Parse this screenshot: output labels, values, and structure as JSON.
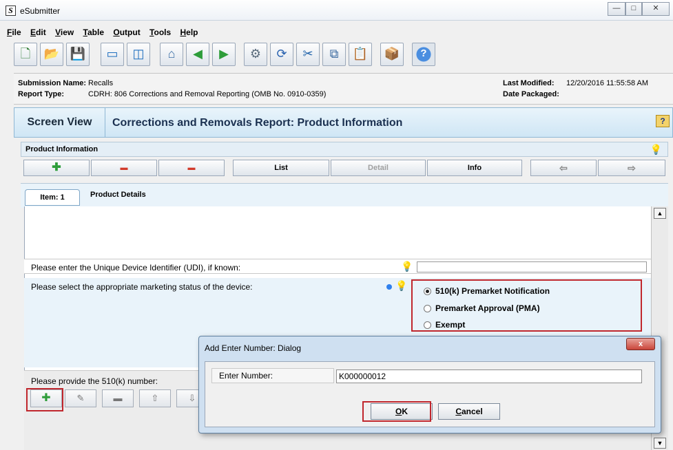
{
  "window": {
    "logo_letter": "S",
    "title": "eSubmitter",
    "minimize": "—",
    "maximize": "□",
    "close": "✕"
  },
  "menu": [
    {
      "accel": "F",
      "rest": "ile"
    },
    {
      "accel": "E",
      "rest": "dit"
    },
    {
      "accel": "V",
      "rest": "iew"
    },
    {
      "accel": "T",
      "rest": "able"
    },
    {
      "accel": "O",
      "rest": "utput"
    },
    {
      "accel": "T",
      "rest": "ools"
    },
    {
      "accel": "H",
      "rest": "elp"
    }
  ],
  "toolbar": {
    "icons": [
      "new-document-icon",
      "open-folder-icon",
      "save-icon",
      "window-icon",
      "split-view-icon",
      "home-icon",
      "back-icon",
      "forward-icon",
      "settings-icon",
      "refresh-icon",
      "cut-icon",
      "copy-icon",
      "paste-icon",
      "package-icon",
      "help-icon"
    ],
    "glyphs": [
      "🗋",
      "📂",
      "💾",
      "▭",
      "◫",
      "⌂",
      "◀",
      "▶",
      "⚙",
      "⟳",
      "✂",
      "⧉",
      "📋",
      "📦",
      "?"
    ]
  },
  "submission": {
    "name_label": "Submission Name:",
    "name_value": "Recalls",
    "type_label": "Report Type:",
    "type_value": "CDRH: 806 Corrections and Removal Reporting (OMB No. 0910-0359)",
    "modified_label": "Last Modified:",
    "modified_value": "12/20/2016 11:55:58 AM",
    "packaged_label": "Date Packaged:",
    "packaged_value": ""
  },
  "screen_view": {
    "tab_label": "Screen View",
    "title": "Corrections and Removals Report: Product Information",
    "help_glyph": "?"
  },
  "product_info": {
    "header": "Product Information",
    "buttons": {
      "add": "✚",
      "delete": "▬",
      "delete_all": "▬",
      "list": "List",
      "detail": "Detail",
      "info": "Info",
      "prev": "⇦",
      "next": "⇨"
    }
  },
  "item": {
    "tab_label": "Item: 1",
    "section_title": "Product Details"
  },
  "questions": {
    "udi": "Please enter the Unique Device Identifier (UDI), if known:",
    "udi_value": "",
    "marketing_status": "Please select the appropriate marketing status of the device:",
    "options": [
      "510(k) Premarket Notification",
      "Premarket Approval (PMA)",
      "Exempt"
    ],
    "selected_index": 0,
    "number_510k": "Please provide the 510(k) number:"
  },
  "subtoolbar": {
    "glyphs": [
      "✚",
      "✎",
      "▬",
      "⇧",
      "⇩"
    ]
  },
  "dialog": {
    "title": "Add Enter Number: Dialog",
    "close": "x",
    "label": "Enter Number:",
    "value": "K000000012",
    "ok_accel": "O",
    "ok_rest": "K",
    "cancel_accel": "C",
    "cancel_rest": "ancel"
  },
  "scroll": {
    "up": "▲",
    "down": "▼"
  }
}
